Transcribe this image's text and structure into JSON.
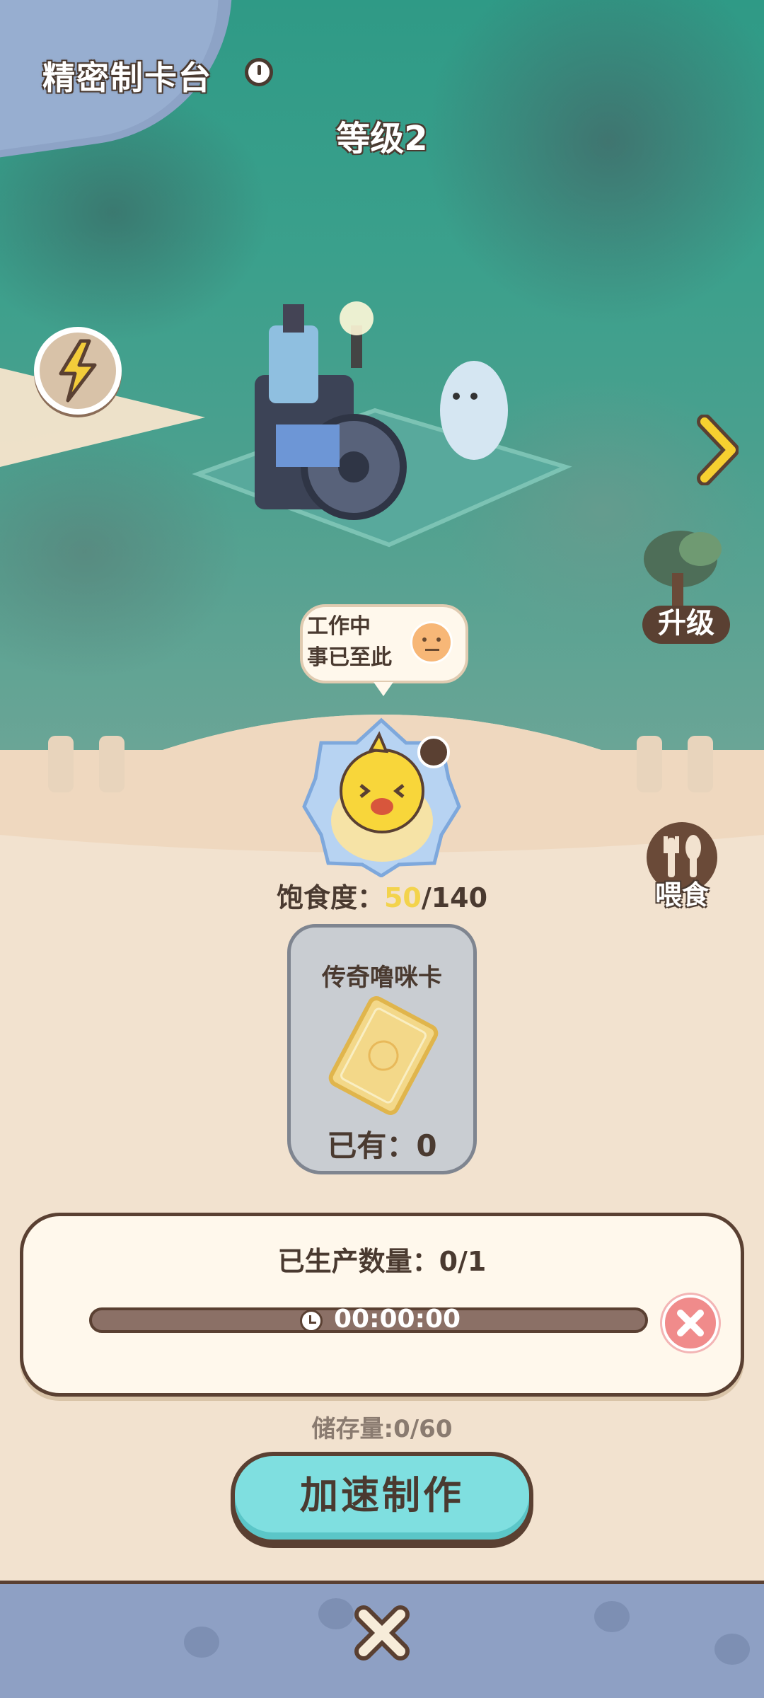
{
  "header": {
    "title": "精密制卡台",
    "level": "等级2"
  },
  "scene": {
    "status_line1": "工作中",
    "status_line2": "事已至此",
    "upgrade_label": "升级"
  },
  "pet": {
    "satiety_label": "饱食度：",
    "satiety_current": "50",
    "satiety_max": "/140",
    "feed_label": "喂食"
  },
  "card": {
    "name": "传奇噜咪卡",
    "owned": "已有：0"
  },
  "production": {
    "label": "已生产数量：0/1",
    "progress_percent": 0,
    "time": "00:00:00",
    "storage": "储存量:0/60"
  },
  "actions": {
    "speed_up_label": "加速制作"
  },
  "colors": {
    "accent": "#7fdfe0",
    "panel": "#f2e2cf",
    "dark": "#5a4032",
    "satiety": "#f3d34c",
    "cancel": "#f08b8b"
  },
  "icons": [
    "info-icon",
    "lightning-icon",
    "arrow-right-icon",
    "refresh-icon",
    "feed-icon",
    "clock-icon",
    "close-icon"
  ]
}
